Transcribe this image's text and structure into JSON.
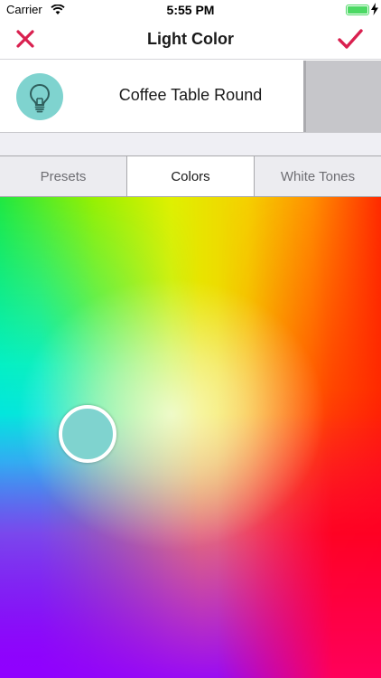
{
  "status_bar": {
    "carrier": "Carrier",
    "time": "5:55 PM",
    "battery_level": 1.0,
    "battery_color": "#4cd964",
    "charging": true
  },
  "nav": {
    "title": "Light Color",
    "cancel_icon": "close-icon",
    "confirm_icon": "checkmark-icon",
    "accent_color": "#d9204f"
  },
  "light": {
    "name": "Coffee Table Round",
    "icon": "lightbulb-icon",
    "icon_background": "#7fd3cf"
  },
  "tabs": [
    {
      "label": "Presets",
      "active": false
    },
    {
      "label": "Colors",
      "active": true
    },
    {
      "label": "White Tones",
      "active": false
    }
  ],
  "picker": {
    "selected_color": "#7fd3cf"
  }
}
